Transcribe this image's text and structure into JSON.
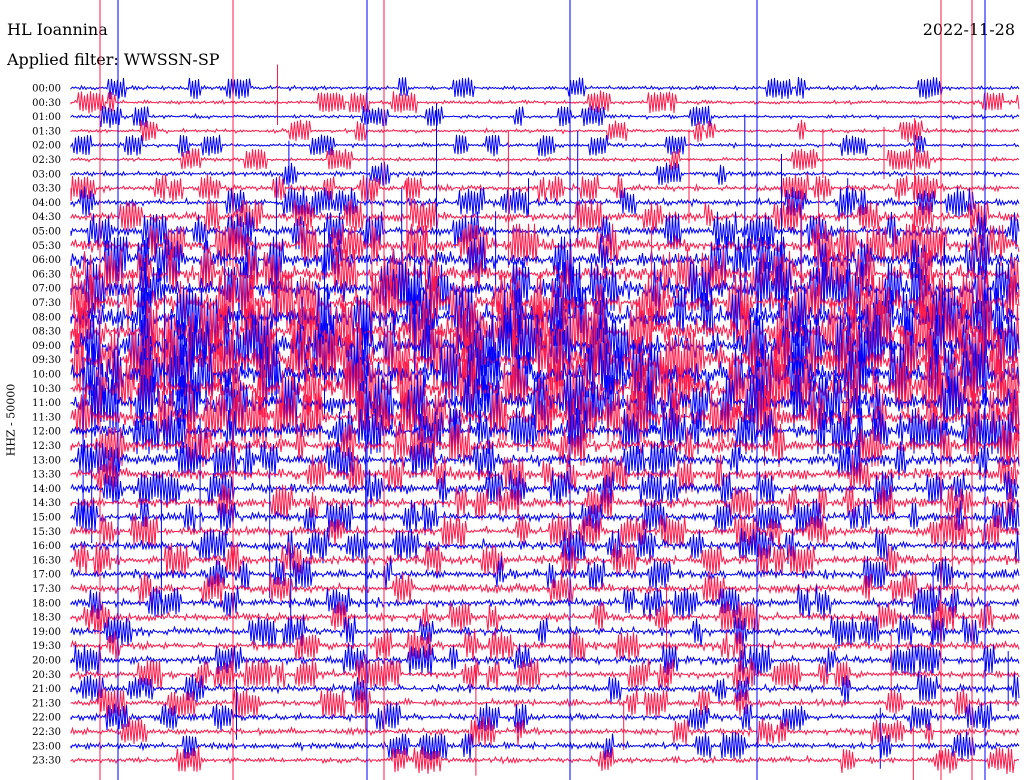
{
  "header": {
    "station": "HL Ioannina",
    "filter_label": "Applied filter: WWSSN-SP",
    "date": "2022-11-28"
  },
  "channel_label": "HHZ - 50000",
  "colors": {
    "odd_trace": "#0000ff",
    "even_trace": "#ff1a4a"
  },
  "chart_data": {
    "type": "line",
    "title": "HL Ioannina",
    "subtitle": "Applied filter: WWSSN-SP",
    "date": "2022-11-28",
    "ylabel": "HHZ - 50000",
    "row_labels": [
      "00:00",
      "00:30",
      "01:00",
      "01:30",
      "02:00",
      "02:30",
      "03:00",
      "03:30",
      "04:00",
      "04:30",
      "05:00",
      "05:30",
      "06:00",
      "06:30",
      "07:00",
      "07:30",
      "08:00",
      "08:30",
      "09:00",
      "09:30",
      "10:00",
      "10:30",
      "11:00",
      "11:30",
      "12:00",
      "12:30",
      "13:00",
      "13:30",
      "14:00",
      "14:30",
      "15:00",
      "15:30",
      "16:00",
      "16:30",
      "17:00",
      "17:30",
      "18:00",
      "18:30",
      "19:00",
      "19:30",
      "20:00",
      "20:30",
      "21:00",
      "21:30",
      "22:00",
      "22:30",
      "23:00",
      "23:30"
    ],
    "row_activity": [
      1,
      1,
      1,
      1,
      1,
      1,
      1.2,
      1.6,
      1.8,
      2.2,
      2.8,
      3.5,
      4,
      4.5,
      5,
      5.5,
      6,
      6.5,
      6.5,
      6.5,
      6.5,
      6,
      5.5,
      5,
      4,
      3.5,
      3,
      2.8,
      2.6,
      2.5,
      2.4,
      2.4,
      2.4,
      2.4,
      2.3,
      2.2,
      2.2,
      2.1,
      2,
      2,
      2,
      1.9,
      1.8,
      1.8,
      1.7,
      1.6,
      1.6,
      1.5
    ],
    "row_colors": [
      "blue",
      "red"
    ],
    "grid": false
  }
}
